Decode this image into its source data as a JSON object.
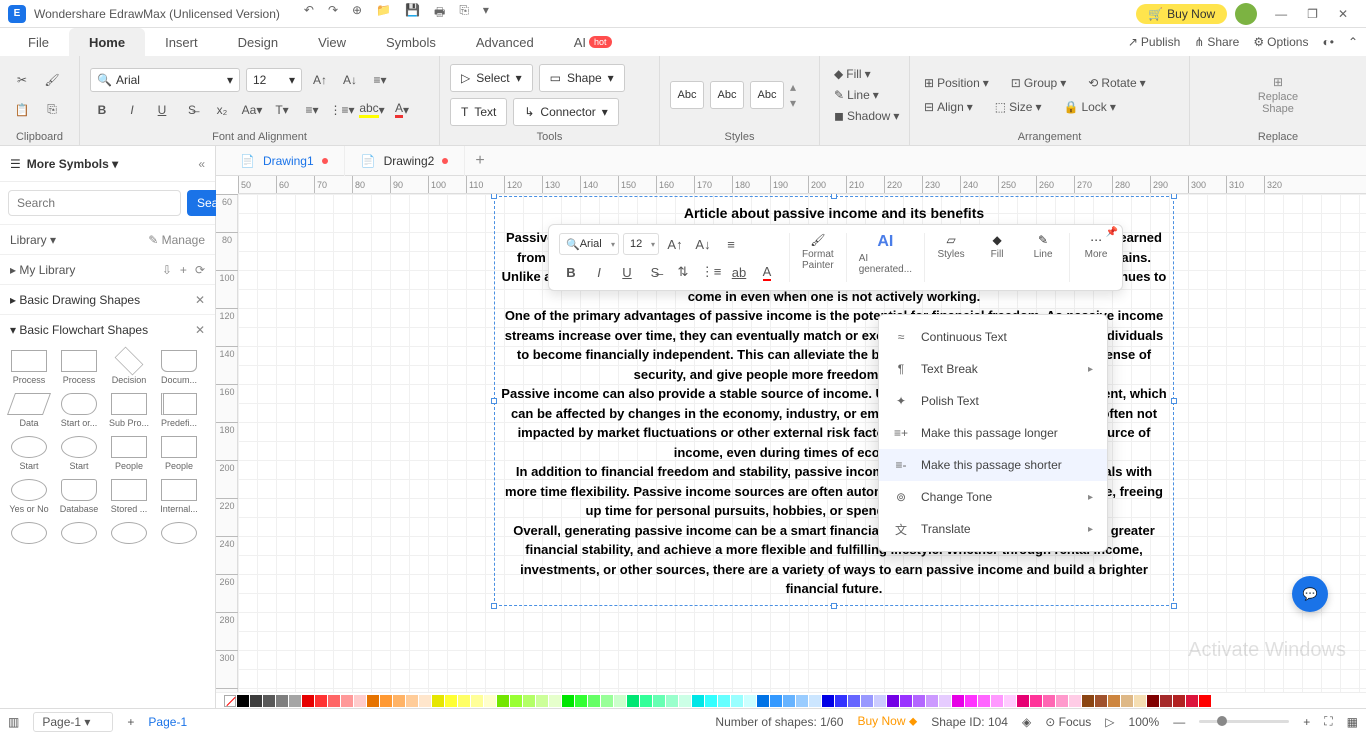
{
  "app": {
    "title": "Wondershare EdrawMax (Unlicensed Version)",
    "buy_label": "Buy Now"
  },
  "menu": {
    "tabs": [
      "File",
      "Home",
      "Insert",
      "Design",
      "View",
      "Symbols",
      "Advanced",
      "AI"
    ],
    "active": "Home",
    "right": {
      "publish": "Publish",
      "share": "Share",
      "options": "Options"
    }
  },
  "ribbon": {
    "clipboard_label": "Clipboard",
    "font_label": "Font and Alignment",
    "font_family": "Arial",
    "font_size": "12",
    "tools_label": "Tools",
    "select_label": "Select",
    "shape_label": "Shape",
    "text_label": "Text",
    "connector_label": "Connector",
    "abc": "Abc",
    "styles_label": "Styles",
    "fill": "Fill",
    "line": "Line",
    "shadow": "Shadow",
    "arrange_label": "Arrangement",
    "position": "Position",
    "align": "Align",
    "group": "Group",
    "size": "Size",
    "rotate": "Rotate",
    "lock": "Lock",
    "replace_label": "Replace",
    "replace_shape": "Replace\nShape"
  },
  "leftpanel": {
    "more_symbols": "More Symbols",
    "search_placeholder": "Search",
    "search_btn": "Search",
    "library": "Library",
    "manage": "Manage",
    "my_library": "My Library",
    "basic_drawing": "Basic Drawing Shapes",
    "basic_flowchart": "Basic Flowchart Shapes",
    "shapes": [
      [
        "Process",
        "Process",
        "Decision",
        "Docum..."
      ],
      [
        "Data",
        "Start or...",
        "Sub Pro...",
        "Predefi..."
      ],
      [
        "Start",
        "Start",
        "People",
        "People"
      ],
      [
        "Yes or No",
        "Database",
        "Stored ...",
        "Internal..."
      ]
    ]
  },
  "doctabs": {
    "d1": "Drawing1",
    "d2": "Drawing2"
  },
  "ruler": {
    "start": 50,
    "step": 10,
    "count": 28,
    "vstart": 60,
    "vstep": 20,
    "vcount": 14
  },
  "article": {
    "title": "Article about passive income and its benefits",
    "p1": "Passive income refers to money earned without actively working or exerting effort to maintain. It is earned from a variety of sources, such as rental income from property, dividend payouts, or investment gains. Unlike active income, where one works and gets paid for their immediate time, passive income continues to come in even when one is not actively working.",
    "p2": "One of the primary advantages of passive income is the potential for financial freedom. As passive income streams increase over time, they can eventually match or exceed one's active income, allowing individuals to become financially independent. This can alleviate the burden of financial stress, provide a sense of security, and give people more freedom to pursue their interests.",
    "p3": "Passive income can also provide a stable source of income. Unlike regular job or active employment, which can be affected by changes in the economy, industry, or employer, passive income streams are often not impacted by market fluctuations or other external risk factors. This can make them a reliable source of income, even during times of economic uncertainty.",
    "p4": "In addition to financial freedom and stability, passive income streams can also provide individuals with more time flexibility. Passive income sources are often automated or require minimal maintenance, freeing up time for personal pursuits, hobbies, or spending time with family and friends.",
    "p5": "Overall, generating passive income can be a smart financial strategy to help build wealth, create greater financial stability, and achieve a more flexible and fulfilling lifestyle. Whether through rental income, investments, or other sources, there are a variety of ways to earn passive income and build a brighter financial future."
  },
  "floatbar": {
    "font": "Arial",
    "size": "12",
    "format_painter": "Format\nPainter",
    "ai": "AI\ngenerated...",
    "styles": "Styles",
    "fill": "Fill",
    "line": "Line",
    "more": "More"
  },
  "ctxmenu": {
    "continuous": "Continuous Text",
    "break": "Text Break",
    "polish": "Polish Text",
    "longer": "Make this passage longer",
    "shorter": "Make this passage shorter",
    "tone": "Change Tone",
    "translate": "Translate"
  },
  "status": {
    "page_sel": "Page-1",
    "page_tab": "Page-1",
    "shapes": "Number of shapes: 1/60",
    "buy": "Buy Now",
    "shape_id": "Shape ID: 104",
    "focus": "Focus",
    "zoom": "100%"
  },
  "watermark": "Activate Windows",
  "colors": [
    "#000000",
    "#3d3d3d",
    "#595959",
    "#7f7f7f",
    "#a5a5a5",
    "#e60000",
    "#ff3333",
    "#ff6666",
    "#ff9999",
    "#ffcccc",
    "#e67300",
    "#ff9933",
    "#ffb366",
    "#ffcc99",
    "#ffe6cc",
    "#e6e600",
    "#ffff33",
    "#ffff66",
    "#ffff99",
    "#ffffcc",
    "#73e600",
    "#99ff33",
    "#b3ff66",
    "#ccff99",
    "#e6ffcc",
    "#00e600",
    "#33ff33",
    "#66ff66",
    "#99ff99",
    "#ccffcc",
    "#00e673",
    "#33ff99",
    "#66ffb3",
    "#99ffcc",
    "#ccffe6",
    "#00e6e6",
    "#33ffff",
    "#66ffff",
    "#99ffff",
    "#ccffff",
    "#0073e6",
    "#3399ff",
    "#66b3ff",
    "#99ccff",
    "#cce6ff",
    "#0000e6",
    "#3333ff",
    "#6666ff",
    "#9999ff",
    "#ccccff",
    "#7300e6",
    "#9933ff",
    "#b366ff",
    "#cc99ff",
    "#e6ccff",
    "#e600e6",
    "#ff33ff",
    "#ff66ff",
    "#ff99ff",
    "#ffccff",
    "#e60073",
    "#ff3399",
    "#ff66b3",
    "#ff99cc",
    "#ffcce6",
    "#8b4513",
    "#a0522d",
    "#cd853f",
    "#deb887",
    "#f5deb3",
    "#800000",
    "#a52a2a",
    "#b22222",
    "#dc143c",
    "#ff0000"
  ]
}
